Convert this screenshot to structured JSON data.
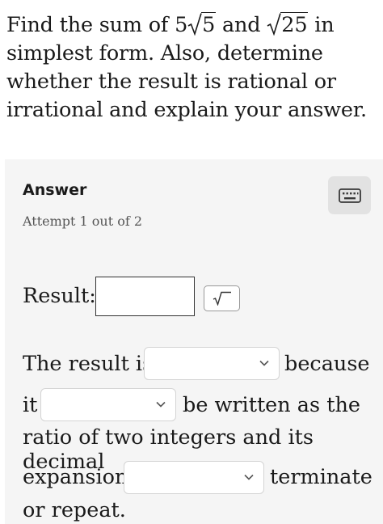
{
  "question": {
    "part1": "Find the sum of ",
    "coef": "5",
    "radicand1": "5",
    "part2": " and ",
    "radicand2": "25",
    "part3": " in simplest form. Also, determine whether the result is rational or irrational and explain your answer."
  },
  "answer": {
    "title": "Answer",
    "attempt": "Attempt 1 out of 2",
    "keyboard_icon": "keyboard-icon",
    "sqrt_button_icon": "square-root-icon"
  },
  "form": {
    "result_label": "Result:",
    "result_value": "",
    "line1_prefix": "The result is",
    "line1_suffix": "because",
    "line2_prefix": "it",
    "line2_suffix": "be written as the",
    "line3": "ratio of two integers and its decimal",
    "line4_prefix": "expansion",
    "line4_suffix": "terminate",
    "line5": "or repeat.",
    "dropdown1_value": "",
    "dropdown2_value": "",
    "dropdown3_value": ""
  }
}
